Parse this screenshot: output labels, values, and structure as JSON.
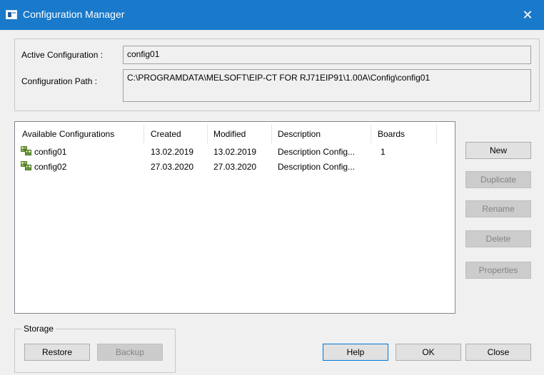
{
  "window": {
    "title": "Configuration Manager",
    "close_glyph": "✕"
  },
  "active": {
    "label": "Active Configuration :",
    "value": "config01",
    "path_label": "Configuration Path :",
    "path_value": "C:\\PROGRAMDATA\\MELSOFT\\EIP-CT FOR RJ71EIP91\\1.00A\\Config\\config01"
  },
  "list": {
    "columns": [
      "Available Configurations",
      "Created",
      "Modified",
      "Description",
      "Boards"
    ],
    "rows": [
      {
        "name": "config01",
        "created": "13.02.2019",
        "modified": "13.02.2019",
        "description": "Description Config...",
        "boards": "1",
        "icon": "config-icon"
      },
      {
        "name": "config02",
        "created": "27.03.2020",
        "modified": "27.03.2020",
        "description": "Description Config...",
        "boards": "",
        "icon": "config-icon"
      }
    ]
  },
  "buttons": {
    "new": "New",
    "duplicate": "Duplicate",
    "rename": "Rename",
    "delete": "Delete",
    "properties": "Properties",
    "help": "Help",
    "ok": "OK",
    "close": "Close"
  },
  "storage": {
    "label": "Storage",
    "restore": "Restore",
    "backup": "Backup"
  },
  "colors": {
    "titlebar": "#1979ca",
    "window_bg": "#f0f0f0",
    "disabled_text": "#838383"
  }
}
